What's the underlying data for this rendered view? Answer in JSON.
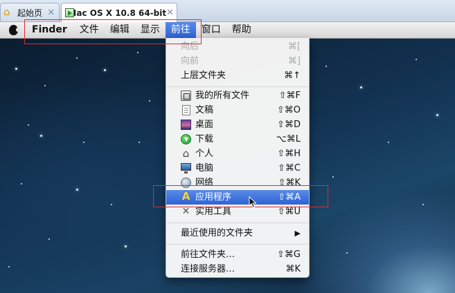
{
  "host_tabs": [
    {
      "label": "起始页",
      "icon": "home-icon",
      "close": "✕"
    },
    {
      "label": "Mac OS X 10.8 64-bit",
      "icon": "vm-icon",
      "close": "✕"
    }
  ],
  "menubar": {
    "apple_icon": "apple-icon",
    "app_name": "Finder",
    "menus": [
      "文件",
      "编辑",
      "显示",
      "前往",
      "窗口",
      "帮助"
    ],
    "active_menu": "前往"
  },
  "go_menu": {
    "items": [
      {
        "label": "向后",
        "shortcut": "⌘[",
        "disabled": true
      },
      {
        "label": "向前",
        "shortcut": "⌘]",
        "disabled": true
      },
      {
        "label": "上层文件夹",
        "shortcut": "⌘↑"
      },
      {
        "label": "我的所有文件",
        "shortcut": "⇧⌘F",
        "icon": "all-files-icon"
      },
      {
        "label": "文稿",
        "shortcut": "⇧⌘O",
        "icon": "documents-icon"
      },
      {
        "label": "桌面",
        "shortcut": "⇧⌘D",
        "icon": "desktop-icon"
      },
      {
        "label": "下载",
        "shortcut": "⌥⌘L",
        "icon": "downloads-icon"
      },
      {
        "label": "个人",
        "shortcut": "⇧⌘H",
        "icon": "home-icon"
      },
      {
        "label": "电脑",
        "shortcut": "⇧⌘C",
        "icon": "computer-icon"
      },
      {
        "label": "网络",
        "shortcut": "⇧⌘K",
        "icon": "network-icon"
      },
      {
        "label": "应用程序",
        "shortcut": "⇧⌘A",
        "icon": "applications-icon",
        "highlighted": true
      },
      {
        "label": "实用工具",
        "shortcut": "⇧⌘U",
        "icon": "utilities-icon"
      },
      {
        "label": "最近使用的文件夹",
        "submenu_arrow": "▶"
      },
      {
        "label": "前往文件夹…",
        "shortcut": "⇧⌘G"
      },
      {
        "label": "连接服务器…",
        "shortcut": "⌘K"
      }
    ]
  },
  "colors": {
    "highlight": "#2d63d6",
    "annotation": "#e22a2a"
  }
}
